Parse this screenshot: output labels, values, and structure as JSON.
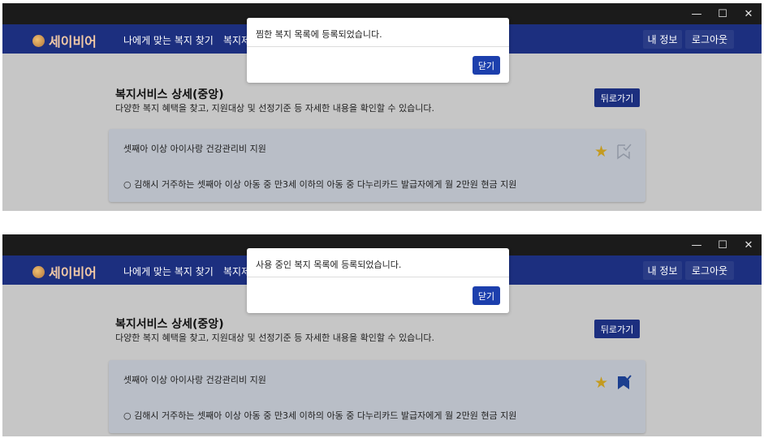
{
  "screens": [
    {
      "window_controls": [
        "—",
        "☐",
        "✕"
      ],
      "logo_text": "세이비어",
      "nav": [
        "나에게 맞는 복지 찾기",
        "복지제"
      ],
      "my_info": "내 정보",
      "logout": "로그아웃",
      "page_title": "복지서비스 상세(중앙)",
      "page_desc": "다양한 복지 혜택을 찾고, 지원대상 및 선정기준 등 자세한 내용을 확인할 수 있습니다.",
      "back_label": "뒤로가기",
      "card_title": "셋째아 이상 아이사랑 건강관리비 지원",
      "card_body": "○ 김해시 거주하는 셋째아 이상 아동 중 만3세 이하의 아동 중 다누리카드 발급자에게 월 2만원 현금 지원",
      "favorited": true,
      "in_use": false,
      "modal_message": "찜한 복지 목록에 등록되었습니다.",
      "modal_close": "닫기"
    },
    {
      "window_controls": [
        "—",
        "☐",
        "✕"
      ],
      "logo_text": "세이비어",
      "nav": [
        "나에게 맞는 복지 찾기",
        "복지제"
      ],
      "my_info": "내 정보",
      "logout": "로그아웃",
      "page_title": "복지서비스 상세(중앙)",
      "page_desc": "다양한 복지 혜택을 찾고, 지원대상 및 선정기준 등 자세한 내용을 확인할 수 있습니다.",
      "back_label": "뒤로가기",
      "card_title": "셋째아 이상 아이사랑 건강관리비 지원",
      "card_body": "○ 김해시 거주하는 셋째아 이상 아동 중 만3세 이하의 아동 중 다누리카드 발급자에게 월 2만원 현금 지원",
      "favorited": true,
      "in_use": true,
      "modal_message": "사용 중인 복지 목록에 등록되었습니다.",
      "modal_close": "닫기"
    }
  ],
  "colors": {
    "navbar": "#1c2f7f",
    "titlebar": "#1b1b1b",
    "overlay_bg": "#c6c6c6",
    "card_bg": "#b9bec7",
    "star": "#c49b20",
    "bookmark_active": "#1c3f8f",
    "primary_button": "#1c3fad"
  },
  "icons": {
    "star": "star-icon",
    "bookmark": "bookmark-check-icon"
  }
}
